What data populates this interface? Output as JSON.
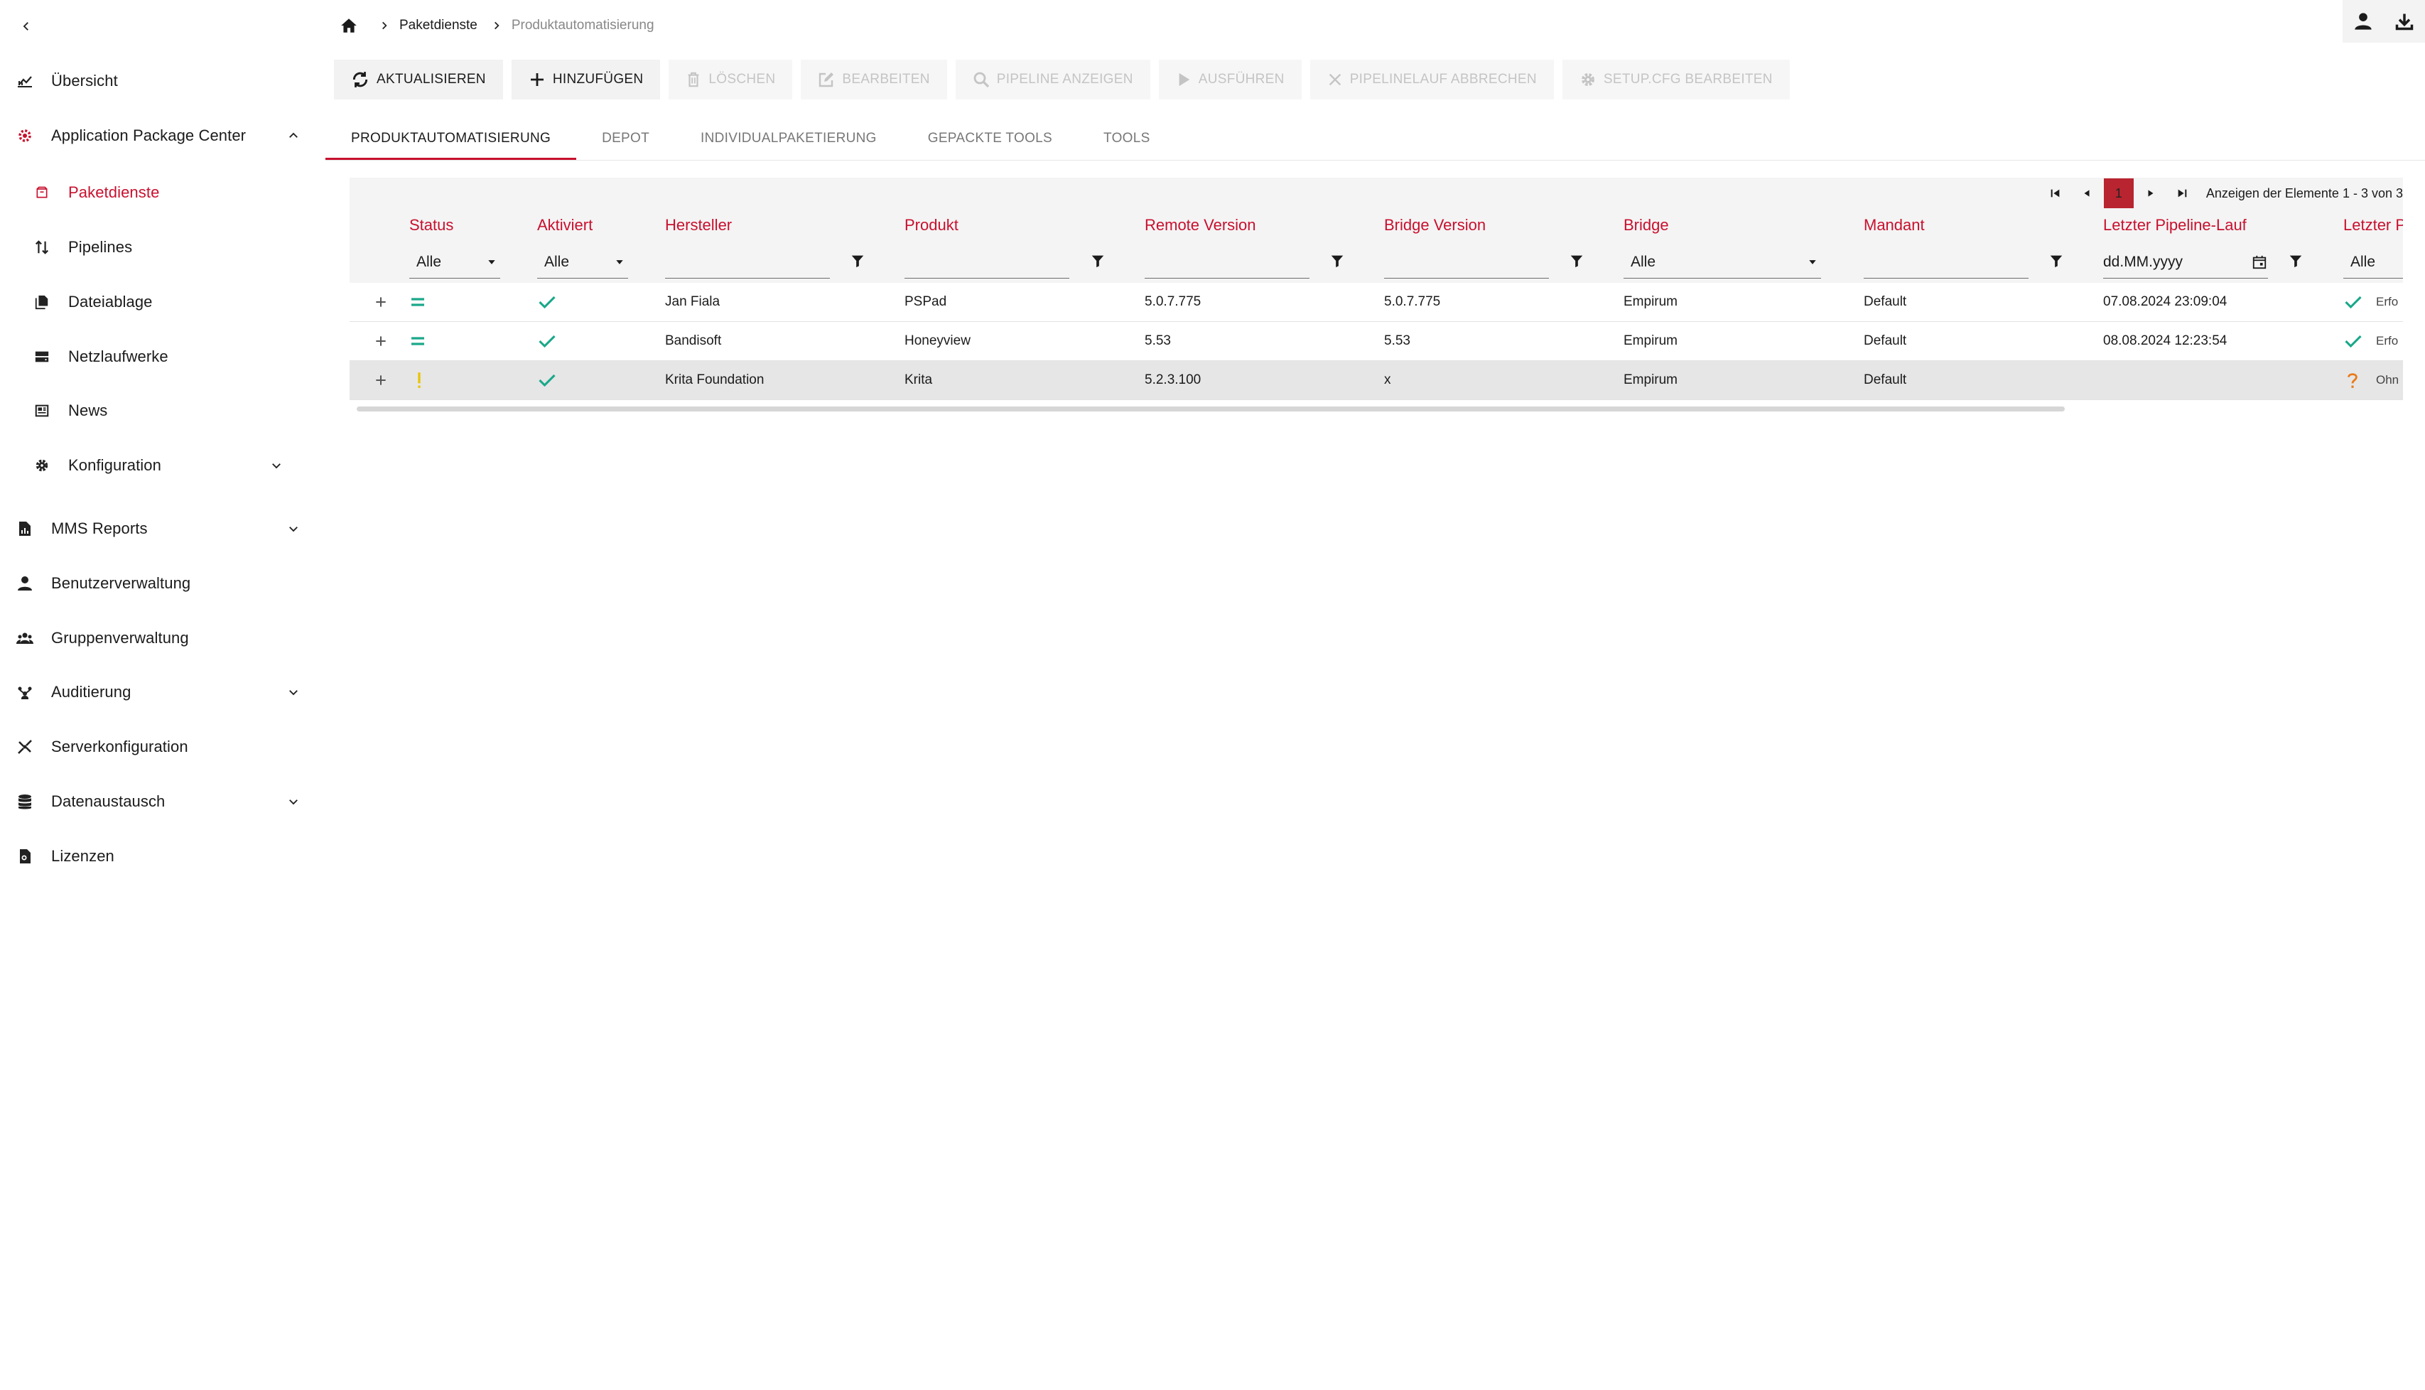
{
  "sidebar": {
    "items": [
      {
        "label": "Übersicht"
      },
      {
        "label": "Application Package Center"
      },
      {
        "label": "Paketdienste"
      },
      {
        "label": "Pipelines"
      },
      {
        "label": "Dateiablage"
      },
      {
        "label": "Netzlaufwerke"
      },
      {
        "label": "News"
      },
      {
        "label": "Konfiguration"
      },
      {
        "label": "MMS Reports"
      },
      {
        "label": "Benutzerverwaltung"
      },
      {
        "label": "Gruppenverwaltung"
      },
      {
        "label": "Auditierung"
      },
      {
        "label": "Serverkonfiguration"
      },
      {
        "label": "Datenaustausch"
      },
      {
        "label": "Lizenzen"
      }
    ]
  },
  "breadcrumb": {
    "items": [
      {
        "label": "Paketdienste"
      },
      {
        "label": "Produktautomatisierung"
      }
    ]
  },
  "toolbar": {
    "buttons": [
      {
        "label": "AKTUALISIEREN",
        "enabled": true
      },
      {
        "label": "HINZUFÜGEN",
        "enabled": true
      },
      {
        "label": "LÖSCHEN",
        "enabled": false
      },
      {
        "label": "BEARBEITEN",
        "enabled": false
      },
      {
        "label": "PIPELINE ANZEIGEN",
        "enabled": false
      },
      {
        "label": "AUSFÜHREN",
        "enabled": false
      },
      {
        "label": "PIPELINELAUF ABBRECHEN",
        "enabled": false
      },
      {
        "label": "SETUP.CFG BEARBEITEN",
        "enabled": false
      }
    ]
  },
  "tabs": [
    {
      "label": "PRODUKTAUTOMATISIERUNG",
      "active": true
    },
    {
      "label": "DEPOT",
      "active": false
    },
    {
      "label": "INDIVIDUALPAKETIERUNG",
      "active": false
    },
    {
      "label": "GEPACKTE TOOLS",
      "active": false
    },
    {
      "label": "TOOLS",
      "active": false
    }
  ],
  "pager": {
    "current_page": "1",
    "info": "Anzeigen der Elemente 1 - 3 von 3"
  },
  "grid": {
    "columns": [
      {
        "title": "Status",
        "filter_value": "Alle",
        "filter_type": "dropdown"
      },
      {
        "title": "Aktiviert",
        "filter_value": "Alle",
        "filter_type": "dropdown"
      },
      {
        "title": "Hersteller",
        "filter_value": "",
        "filter_type": "text"
      },
      {
        "title": "Produkt",
        "filter_value": "",
        "filter_type": "text"
      },
      {
        "title": "Remote Version",
        "filter_value": "",
        "filter_type": "text"
      },
      {
        "title": "Bridge Version",
        "filter_value": "",
        "filter_type": "text"
      },
      {
        "title": "Bridge",
        "filter_value": "Alle",
        "filter_type": "dropdown"
      },
      {
        "title": "Mandant",
        "filter_value": "",
        "filter_type": "text"
      },
      {
        "title": "Letzter Pipeline-Lauf",
        "filter_value": "dd.MM.yyyy",
        "filter_type": "date"
      },
      {
        "title": "Letzter P",
        "filter_value": "Alle",
        "filter_type": "dropdown"
      }
    ],
    "rows": [
      {
        "status": "equal",
        "aktiviert": true,
        "hersteller": "Jan Fiala",
        "produkt": "PSPad",
        "remote_version": "5.0.7.775",
        "bridge_version": "5.0.7.775",
        "bridge": "Empirum",
        "mandant": "Default",
        "letzter_lauf": "07.08.2024 23:09:04",
        "letzter_status": "success",
        "letzter_status_text": "Erfo",
        "selected": false
      },
      {
        "status": "equal",
        "aktiviert": true,
        "hersteller": "Bandisoft",
        "produkt": "Honeyview",
        "remote_version": "5.53",
        "bridge_version": "5.53",
        "bridge": "Empirum",
        "mandant": "Default",
        "letzter_lauf": "08.08.2024 12:23:54",
        "letzter_status": "success",
        "letzter_status_text": "Erfo",
        "selected": false
      },
      {
        "status": "warning",
        "aktiviert": true,
        "hersteller": "Krita Foundation",
        "produkt": "Krita",
        "remote_version": "5.2.3.100",
        "bridge_version": "x",
        "bridge": "Empirum",
        "mandant": "Default",
        "letzter_lauf": "",
        "letzter_status": "unknown",
        "letzter_status_text": "Ohn",
        "selected": true
      }
    ]
  },
  "colors": {
    "accent": "#c8102e",
    "success": "#1aa88a",
    "warning": "#e8c400",
    "unknown": "#e87a1a"
  }
}
